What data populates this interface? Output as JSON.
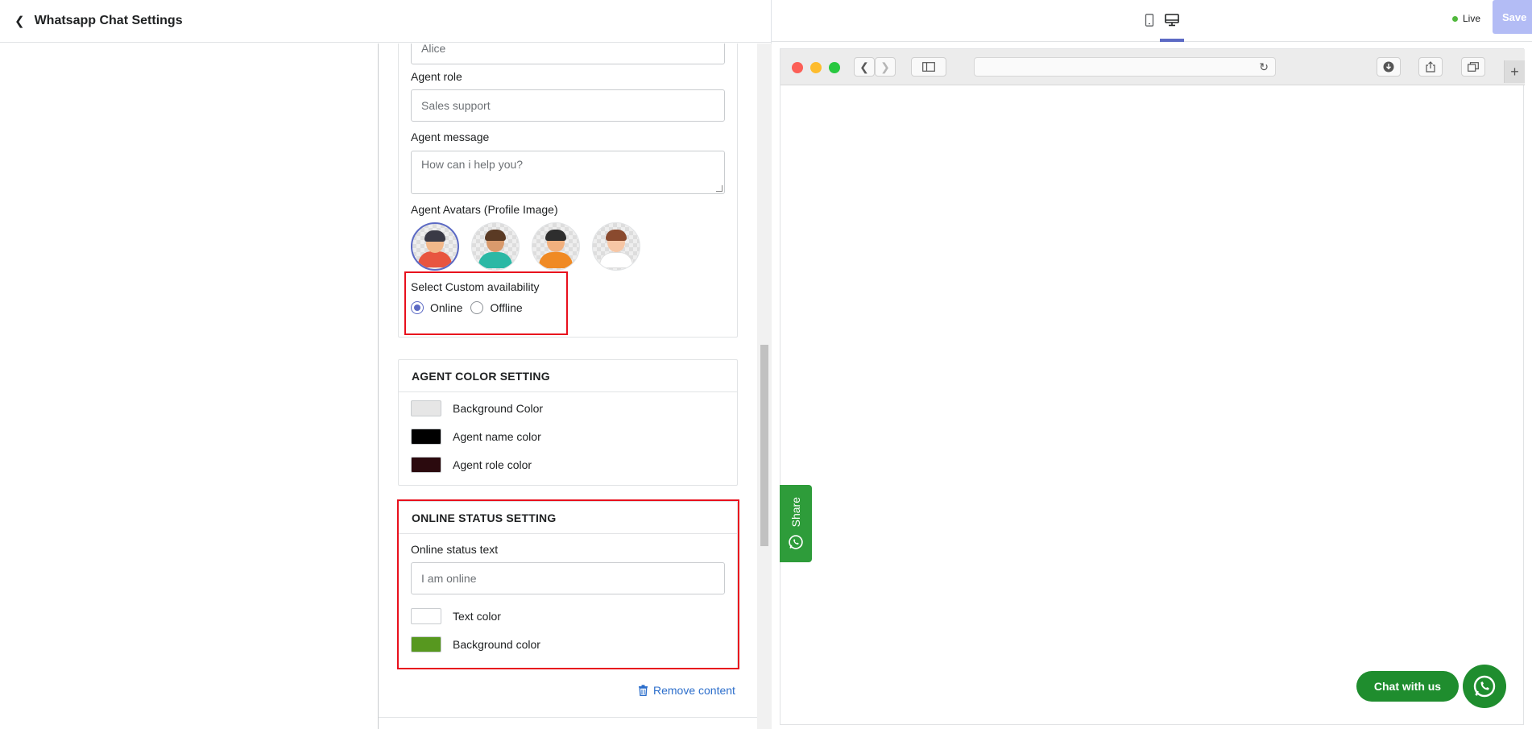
{
  "header": {
    "title": "Whatsapp Chat Settings"
  },
  "agent": {
    "name_value": "Alice",
    "role_label": "Agent role",
    "role_value": "Sales support",
    "message_label": "Agent message",
    "message_value": "How can i help you?",
    "avatars_label": "Agent Avatars (Profile Image)",
    "availability_label": "Select Custom availability",
    "availability_options": [
      "Online",
      "Offline"
    ],
    "availability_selected": "Online"
  },
  "agent_color": {
    "title": "AGENT COLOR SETTING",
    "items": [
      {
        "label": "Background Color",
        "color": "#e6e6e6"
      },
      {
        "label": "Agent name color",
        "color": "#000000"
      },
      {
        "label": "Agent role color",
        "color": "#2b0a0e"
      }
    ]
  },
  "online_status": {
    "title": "ONLINE STATUS SETTING",
    "text_label": "Online status text",
    "text_value": "I am online",
    "items": [
      {
        "label": "Text color",
        "color": "#ffffff"
      },
      {
        "label": "Background color",
        "color": "#57981f"
      }
    ]
  },
  "actions": {
    "remove_label": "Remove content"
  },
  "preview": {
    "live_label": "Live",
    "save_label": "Save",
    "share_label": "Share",
    "chat_label": "Chat with us"
  },
  "colors": {
    "accent": "#5c6ac4",
    "highlight": "#e8101d",
    "whatsapp_green": "#1f8d2e"
  }
}
